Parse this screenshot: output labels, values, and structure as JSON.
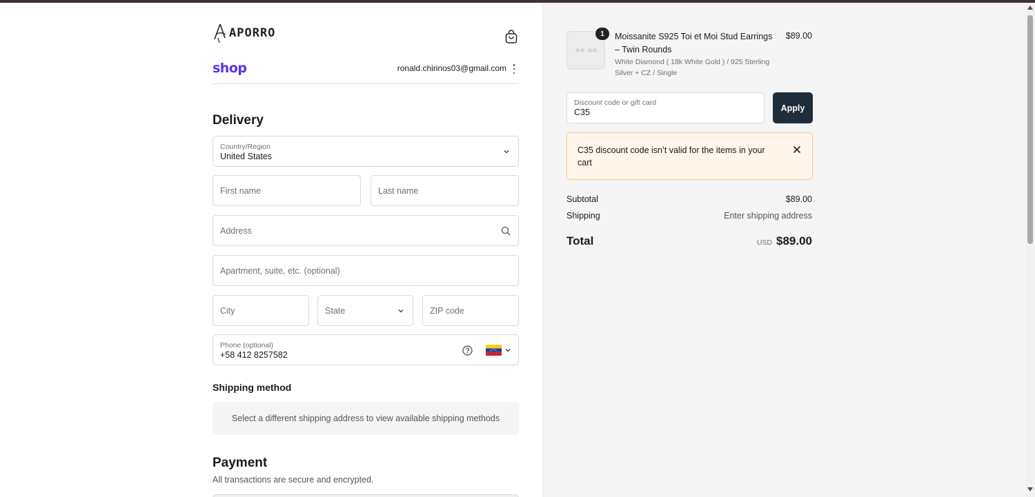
{
  "brand": {
    "name": "APORRO"
  },
  "header": {
    "shop_label": "shop",
    "email": "ronald.chirinos03@gmail.com"
  },
  "delivery": {
    "title": "Delivery",
    "country": {
      "label": "Country/Region",
      "value": "United States"
    },
    "first_name": {
      "placeholder": "First name"
    },
    "last_name": {
      "placeholder": "Last name"
    },
    "address": {
      "placeholder": "Address"
    },
    "apartment": {
      "placeholder": "Apartment, suite, etc. (optional)"
    },
    "city": {
      "placeholder": "City"
    },
    "state": {
      "placeholder": "State"
    },
    "zip": {
      "placeholder": "ZIP code"
    },
    "phone": {
      "label": "Phone (optional)",
      "value": "+58 412 8257582"
    }
  },
  "shipping_method": {
    "title": "Shipping method",
    "message": "Select a different shipping address to view available shipping methods"
  },
  "payment": {
    "title": "Payment",
    "subtitle": "All transactions are secure and encrypted."
  },
  "order": {
    "item": {
      "quantity": "1",
      "name": "Moissanite S925 Toi et Moi Stud Earrings – Twin Rounds",
      "variant": "White Diamond ( 18k White Gold ) / 925 Sterling Silver + CZ / Single",
      "price": "$89.00"
    },
    "discount": {
      "label": "Discount code or gift card",
      "value": "C35",
      "apply_label": "Apply"
    },
    "alert": {
      "message": "C35 discount code isn’t valid for the items in your cart"
    },
    "subtotal": {
      "label": "Subtotal",
      "value": "$89.00"
    },
    "shipping": {
      "label": "Shipping",
      "value": "Enter shipping address"
    },
    "total": {
      "label": "Total",
      "currency": "USD",
      "value": "$89.00"
    }
  },
  "colors": {
    "shop_purple": "#5a31f4",
    "apply_bg": "#1f2d3a",
    "alert_bg": "#fff5ea",
    "alert_border": "#f2c79b"
  }
}
